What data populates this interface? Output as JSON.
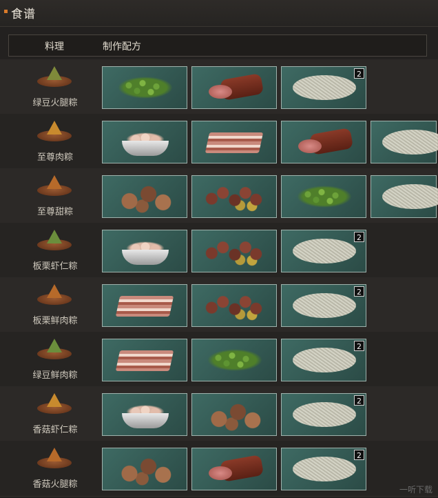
{
  "header": {
    "title": "食谱"
  },
  "columns": {
    "dish": "料理",
    "recipe": "制作配方"
  },
  "rows": [
    {
      "name": "绿豆火腿粽",
      "zongzi": "default",
      "ingredients": [
        {
          "icon": "mung-beans-icon",
          "badge": ""
        },
        {
          "icon": "ham-icon",
          "badge": ""
        },
        {
          "icon": "glutinous-rice-icon",
          "badge": "2"
        }
      ]
    },
    {
      "name": "至尊肉粽",
      "zongzi": "gold",
      "ingredients": [
        {
          "icon": "shrimp-bowl-icon",
          "badge": ""
        },
        {
          "icon": "pork-belly-icon",
          "badge": ""
        },
        {
          "icon": "ham-icon",
          "badge": ""
        },
        {
          "icon": "glutinous-rice-icon",
          "badge": ""
        }
      ]
    },
    {
      "name": "至尊甜粽",
      "zongzi": "orange",
      "ingredients": [
        {
          "icon": "mushroom-icon",
          "badge": ""
        },
        {
          "icon": "chestnut-icon",
          "badge": ""
        },
        {
          "icon": "mung-beans-icon",
          "badge": ""
        },
        {
          "icon": "glutinous-rice-icon",
          "badge": ""
        }
      ]
    },
    {
      "name": "板栗虾仁粽",
      "zongzi": "green",
      "ingredients": [
        {
          "icon": "shrimp-bowl-icon",
          "badge": ""
        },
        {
          "icon": "chestnut-icon",
          "badge": ""
        },
        {
          "icon": "glutinous-rice-icon",
          "badge": "2"
        }
      ]
    },
    {
      "name": "板栗鲜肉粽",
      "zongzi": "orange",
      "ingredients": [
        {
          "icon": "pork-belly-icon",
          "badge": ""
        },
        {
          "icon": "chestnut-icon",
          "badge": ""
        },
        {
          "icon": "glutinous-rice-icon",
          "badge": "2"
        }
      ]
    },
    {
      "name": "绿豆鲜肉粽",
      "zongzi": "green",
      "ingredients": [
        {
          "icon": "pork-belly-icon",
          "badge": ""
        },
        {
          "icon": "mung-beans-icon",
          "badge": ""
        },
        {
          "icon": "glutinous-rice-icon",
          "badge": "2"
        }
      ]
    },
    {
      "name": "香菇虾仁粽",
      "zongzi": "gold",
      "ingredients": [
        {
          "icon": "shrimp-bowl-icon",
          "badge": ""
        },
        {
          "icon": "mushroom-icon",
          "badge": ""
        },
        {
          "icon": "glutinous-rice-icon",
          "badge": "2"
        }
      ]
    },
    {
      "name": "香菇火腿粽",
      "zongzi": "orange",
      "ingredients": [
        {
          "icon": "mushroom-icon",
          "badge": ""
        },
        {
          "icon": "ham-icon",
          "badge": ""
        },
        {
          "icon": "glutinous-rice-icon",
          "badge": "2"
        }
      ]
    }
  ],
  "watermark": "一听下载"
}
